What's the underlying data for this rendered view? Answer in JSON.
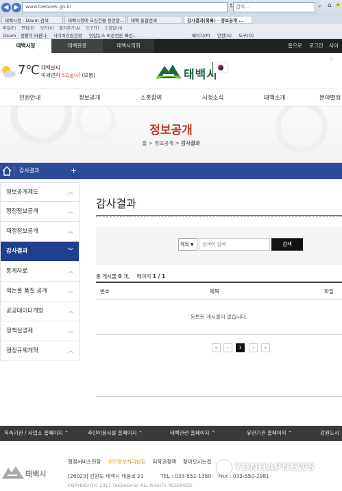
{
  "browser": {
    "address": "www.taebaek.go.kr",
    "search_placeholder": "검색...",
    "tabs": [
      "태백시청 - Daum 검색",
      "태백시청에 모신건물 등연합...",
      "태백 통합검색",
      "감사결과(목록) - 정보공개 ..."
    ],
    "menu": [
      "파일(F)",
      "편집(E)",
      "보기(V)",
      "즐겨찾기(A)",
      "도구(T)",
      "도움말(H)"
    ],
    "favorites": [
      "Daum - 생활이 바뀐다",
      "사이버강원관광",
      "연합뉴스 바른언론 빠른...",
      "페이지(P)",
      "안전(S)",
      "도구(O)"
    ]
  },
  "site_tabs": [
    "태백시청",
    "태백관광",
    "태백시의회"
  ],
  "util_links": [
    "홈으로",
    "로그인",
    "사이트"
  ],
  "weather": {
    "temp": "7℃",
    "name": "태백날씨",
    "dust_label": "미세먼지",
    "dust_value": "52㎍/㎥",
    "dust_status": "(보통)"
  },
  "logo_text": "태백시",
  "main_nav": [
    "민원안내",
    "정보공개",
    "소통참여",
    "시정소식",
    "태백소개",
    "분야별정"
  ],
  "visual": {
    "title": "정보공개",
    "breadcrumb": [
      "홈",
      "정보공개",
      "감사결과"
    ]
  },
  "location": {
    "label": "감사결과",
    "plus": "+"
  },
  "sidebar": [
    {
      "label": "정보공개제도",
      "active": false
    },
    {
      "label": "행정정보공개",
      "active": false
    },
    {
      "label": "재정정보공개",
      "active": false
    },
    {
      "label": "감사결과",
      "active": true
    },
    {
      "label": "통계자료",
      "active": false
    },
    {
      "label": "먹는물 품질 공개",
      "active": false
    },
    {
      "label": "공공데이터개방",
      "active": false
    },
    {
      "label": "정책실명제",
      "active": false
    },
    {
      "label": "행정규제개혁",
      "active": false
    }
  ],
  "content": {
    "title": "감사결과",
    "search": {
      "select_value": "제목",
      "placeholder": "검색어 입력",
      "button": "검색"
    },
    "count": {
      "prefix": "총 게시물",
      "value": "0",
      "suffix": "개,",
      "page_label": "페이지",
      "page_value": "1 / 1"
    },
    "columns": [
      "번호",
      "제목",
      "파일"
    ],
    "empty_message": "등록된 게시물이 없습니다.",
    "pagination": [
      "«",
      "‹",
      "1",
      "›",
      "»"
    ],
    "current_page": "1"
  },
  "footer_links": [
    "직속기관 / 사업소 홈페이지 ⌃",
    "주민이용시설 홈페이지 ⌃",
    "태백관련 홈페이지 ⌃",
    "유관기관 홈페이지 ⌃",
    "강원도시"
  ],
  "footer": {
    "logo_text": "태백시",
    "menu": [
      "행정서비스헌장",
      "개인정보처리방침",
      "저작권정책",
      "찾아오시는길"
    ],
    "address": "[26023] 강원도 태백시 태붐로 21",
    "tel": "TEL : 033-552-1360",
    "fax": "FAX : 033-550-2981",
    "copyright": "COPYRIGHT© 2017 TAEBAEK-SI. ALL RIGHTS RESERVED."
  },
  "watermark": "YONHAPNEWS",
  "colors": {
    "location_bar": "#2a4a9a",
    "sidebar_active": "#1f3f8f",
    "visual_title": "#c0392b",
    "logo_green": "#1b6a3f"
  }
}
